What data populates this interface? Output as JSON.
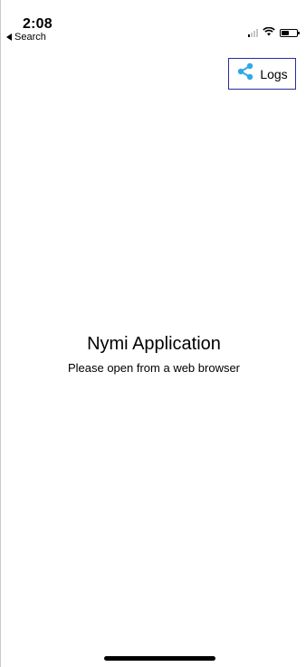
{
  "status_bar": {
    "time": "2:08",
    "back_label": "Search",
    "icons": [
      "cellular-signal-icon",
      "wifi-icon",
      "battery-icon"
    ]
  },
  "header": {
    "logs_button": {
      "label": "Logs",
      "icon": "share-icon",
      "icon_color": "#2FA8E8",
      "border_color": "#2A2BA0"
    }
  },
  "main": {
    "title": "Nymi Application",
    "subtitle": "Please open from a web browser"
  }
}
